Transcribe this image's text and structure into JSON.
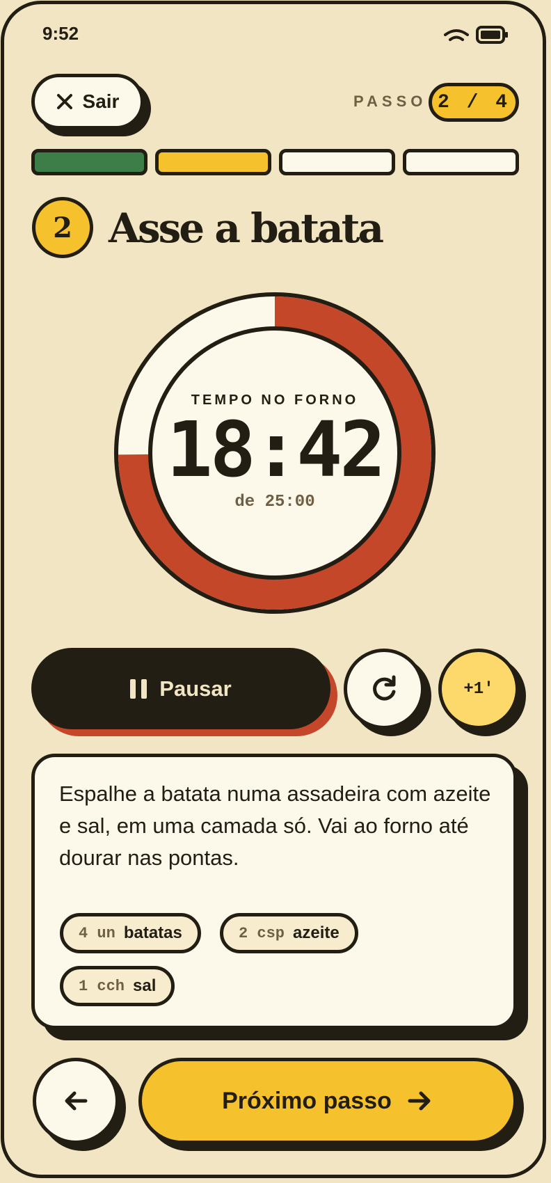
{
  "status_bar": {
    "time": "9:52"
  },
  "header": {
    "exit_label": "Sair",
    "step_label": "PASSO",
    "step_counter": "2 / 4"
  },
  "progress": {
    "segments": [
      "done",
      "current",
      "todo",
      "todo"
    ],
    "colors": {
      "done": "#3d7d48",
      "current": "#f5c22d",
      "todo": "#fcf8ea"
    }
  },
  "step": {
    "number": "2",
    "title": "Asse a batata"
  },
  "timer": {
    "caption": "TEMPO NO FORNO",
    "remaining": "18:42",
    "total": "de 25:00",
    "elapsed_fraction": 0.748,
    "colors": {
      "ring": "#c4472a",
      "track": "#fcf8ea"
    }
  },
  "controls": {
    "pause_label": "Pausar",
    "add_minute_label": "+1'"
  },
  "instruction": {
    "text": "Espalhe a batata numa assadeira com azeite e sal, em uma camada só. Vai ao forno até dourar nas pontas.",
    "ingredients": [
      {
        "qty": "4 un",
        "name": "batatas"
      },
      {
        "qty": "2 csp",
        "name": "azeite"
      },
      {
        "qty": "1 cch",
        "name": "sal"
      }
    ]
  },
  "footer": {
    "next_label": "Próximo passo"
  },
  "palette": {
    "bg": "#f2e5c3",
    "ink": "#231e14",
    "accent": "#f5c22d",
    "red": "#c4472a"
  }
}
